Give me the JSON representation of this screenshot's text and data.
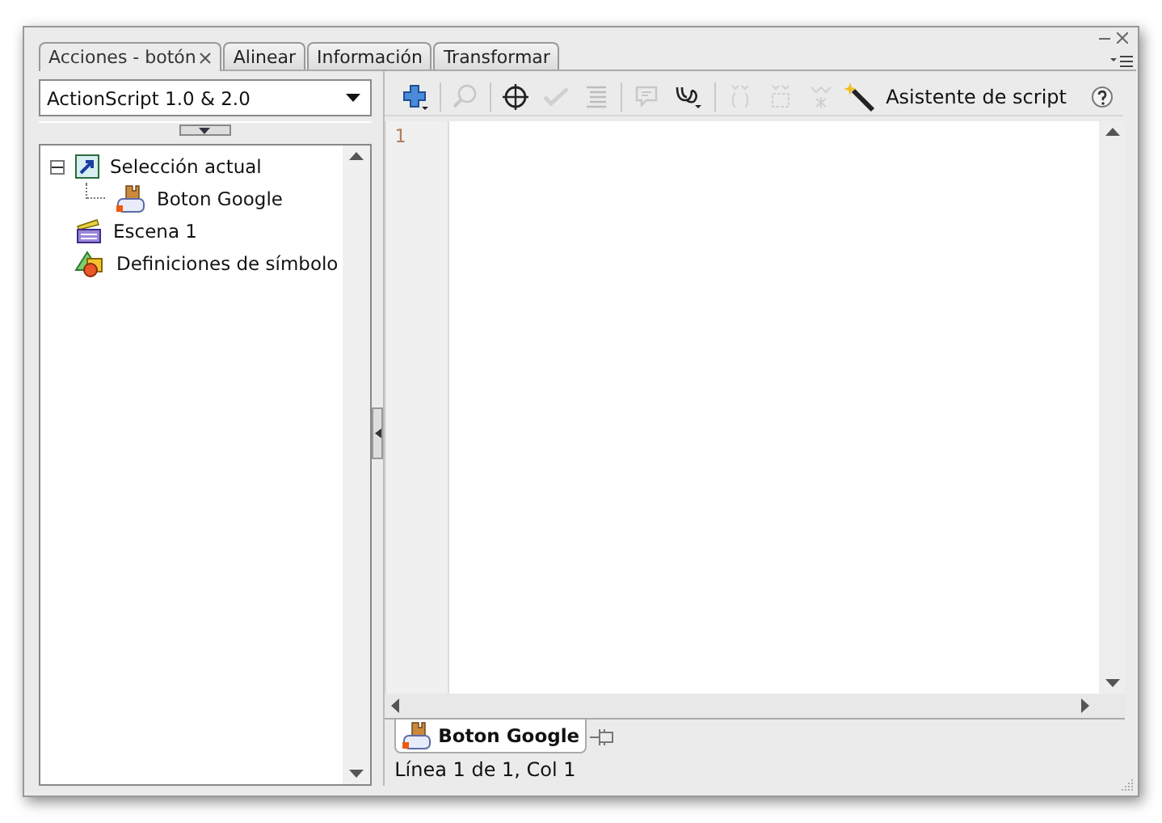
{
  "panel": {
    "tabs": [
      {
        "label": "Acciones - botón",
        "selected": true,
        "closable": true
      },
      {
        "label": "Alinear",
        "selected": false,
        "closable": false
      },
      {
        "label": "Información",
        "selected": false,
        "closable": false
      },
      {
        "label": "Transformar",
        "selected": false,
        "closable": false
      }
    ]
  },
  "language_dropdown": {
    "value": "ActionScript 1.0 & 2.0"
  },
  "tree": [
    {
      "label": "Selección actual",
      "kind": "selection",
      "expanded": true,
      "children": [
        {
          "label": "Boton Google",
          "kind": "button"
        }
      ]
    },
    {
      "label": "Escena 1",
      "kind": "scene"
    },
    {
      "label": "Definiciones de símbolo",
      "kind": "symbols"
    }
  ],
  "toolbar": [
    {
      "kind": "add",
      "disabled": false
    },
    {
      "kind": "find",
      "disabled": true
    },
    {
      "kind": "target",
      "disabled": false
    },
    {
      "kind": "check",
      "disabled": true
    },
    {
      "kind": "format",
      "disabled": true
    },
    {
      "kind": "hint",
      "disabled": true
    },
    {
      "kind": "debug",
      "disabled": false
    },
    {
      "kind": "collapse-between",
      "disabled": true
    },
    {
      "kind": "collapse-selection",
      "disabled": true
    },
    {
      "kind": "expand-all",
      "disabled": true
    }
  ],
  "script_assist": {
    "label": "Asistente de script"
  },
  "editor": {
    "line_numbers": [
      "1"
    ]
  },
  "script_tabs": [
    {
      "label": "Boton Google",
      "selected": true
    }
  ],
  "status_bar": {
    "text": "Línea 1 de 1, Col 1"
  }
}
